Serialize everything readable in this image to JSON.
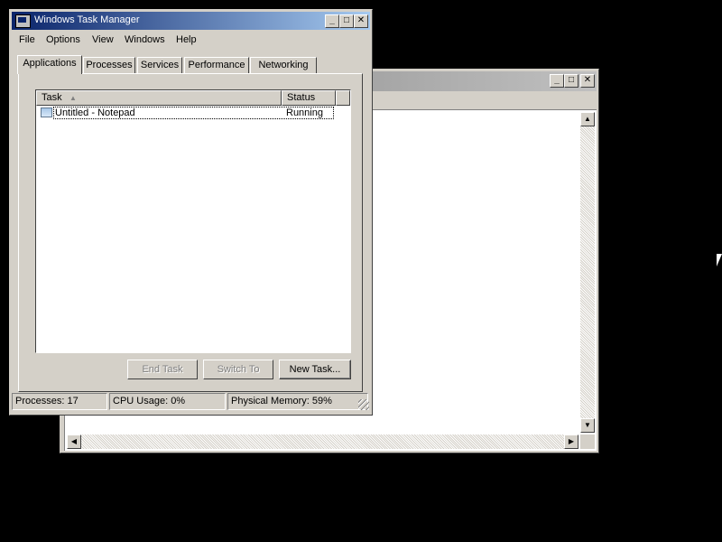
{
  "taskmgr": {
    "title": "Windows Task Manager",
    "menu": [
      "File",
      "Options",
      "View",
      "Windows",
      "Help"
    ],
    "tabs": [
      "Applications",
      "Processes",
      "Services",
      "Performance",
      "Networking"
    ],
    "active_tab": "Applications",
    "columns": [
      "Task",
      "Status"
    ],
    "rows": [
      {
        "task": "Untitled - Notepad",
        "status": "Running",
        "icon": "notepad-icon"
      }
    ],
    "buttons": {
      "end_task": "End Task",
      "switch_to": "Switch To",
      "new_task": "New Task..."
    },
    "status": {
      "processes": "Processes: 17",
      "cpu": "CPU Usage: 0%",
      "memory": "Physical Memory: 59%"
    }
  },
  "caption_buttons": {
    "minimize": "_",
    "maximize": "□",
    "close": "✕"
  },
  "colors": {
    "titlebar_active": "#0a246a",
    "titlebar_inactive": "#808080",
    "face": "#d4d0c8"
  }
}
